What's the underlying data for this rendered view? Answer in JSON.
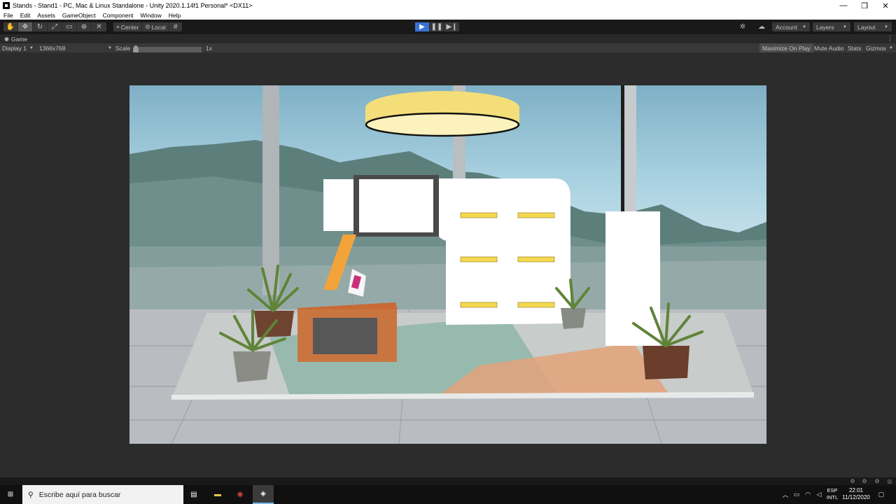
{
  "window": {
    "title": "Stands - Stand1 - PC, Mac & Linux Standalone - Unity 2020.1.14f1 Personal* <DX11>",
    "minimize": "—",
    "maximize": "❐",
    "close": "✕"
  },
  "menu": [
    "File",
    "Edit",
    "Assets",
    "GameObject",
    "Component",
    "Window",
    "Help"
  ],
  "toolbar": {
    "tools": [
      "hand-tool",
      "move-tool",
      "rotate-tool",
      "scale-tool",
      "rect-tool",
      "transform-tool",
      "custom-tool"
    ],
    "active_tool": "move-tool",
    "pivot_label": "Center",
    "space_label": "Local",
    "play_active": true,
    "account_label": "Account",
    "layers_label": "Layers",
    "layout_label": "Layout"
  },
  "game_view": {
    "tab_label": "Game",
    "display_label": "Display 1",
    "resolution_label": "1366x768",
    "scale_label": "Scale",
    "scale_value": "1x",
    "scale_fraction": 0.0,
    "maximize_on_play": "Maximize On Play",
    "mute_audio": "Mute Audio",
    "stats": "Stats",
    "gizmos": "Gizmos"
  },
  "colors": {
    "editor_dark": "#282828",
    "toolbar_bg": "#191919",
    "accent_play": "#3a72d4",
    "lamp_yellow": "#f7e27e",
    "counter_orange": "#c8703d",
    "shelf_yellow": "#f4d84e"
  },
  "taskbar": {
    "search_placeholder": "Escribe aquí para buscar",
    "lang_top": "ESP",
    "lang_bottom": "INTL",
    "time": "22:01",
    "date": "11/12/2020"
  }
}
